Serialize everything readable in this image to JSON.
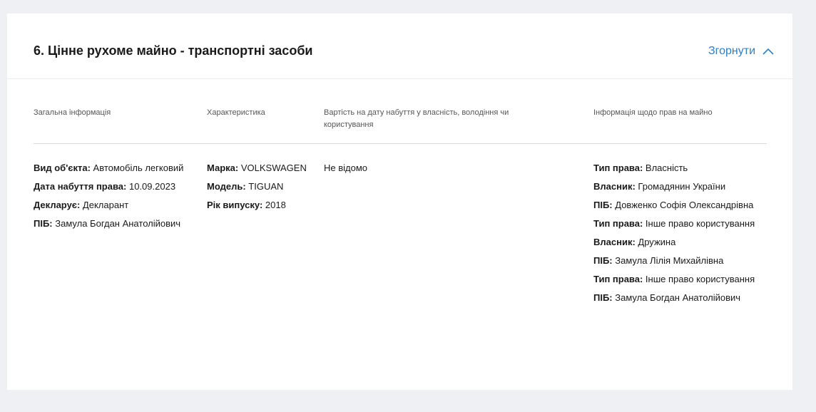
{
  "section": {
    "title": "6. Цінне рухоме майно - транспортні засоби",
    "collapse_label": "Згорнути",
    "collapse_icon": "chevron-up-icon"
  },
  "table": {
    "headers": [
      "Загальна інформація",
      "Характеристика",
      "Вартість на дату набуття у власність, володіння чи користування",
      "Інформація щодо прав на майно"
    ],
    "general": [
      {
        "label": "Вид об'єкта:",
        "value": " Автомобіль легковий"
      },
      {
        "label": "Дата набуття права:",
        "value": " 10.09.2023"
      },
      {
        "label": "Декларує:",
        "value": " Декларант"
      },
      {
        "label": "ПІБ:",
        "value": " Замула Богдан Анатолійович"
      }
    ],
    "characteristics": [
      {
        "label": "Марка:",
        "value": " VOLKSWAGEN"
      },
      {
        "label": "Модель:",
        "value": " TIGUAN"
      },
      {
        "label": "Рік випуску:",
        "value": " 2018"
      }
    ],
    "cost": "Не відомо",
    "rights": [
      {
        "label": "Тип права:",
        "value": " Власність"
      },
      {
        "label": "Власник:",
        "value": " Громадянин України"
      },
      {
        "label": "ПІБ:",
        "value": " Довженко Софія Олександрівна"
      },
      {
        "label": "Тип права:",
        "value": " Інше право користування"
      },
      {
        "label": "Власник:",
        "value": " Дружина"
      },
      {
        "label": "ПІБ:",
        "value": " Замула Лілія Михайлівна"
      },
      {
        "label": "Тип права:",
        "value": " Інше право користування"
      },
      {
        "label": "ПІБ:",
        "value": " Замула Богдан Анатолійович"
      }
    ]
  },
  "colors": {
    "accent": "#2d7fc8",
    "page_background": "#eef0f4",
    "card_background": "#ffffff"
  }
}
